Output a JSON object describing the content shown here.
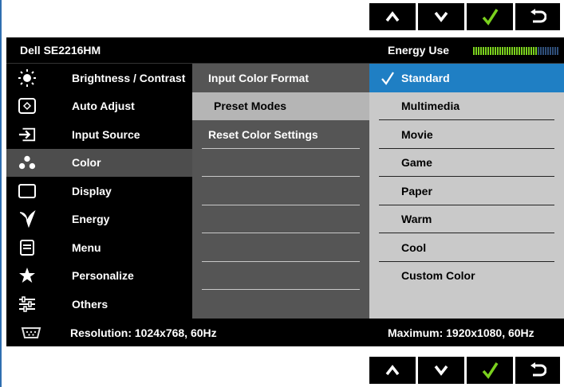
{
  "header": {
    "model": "Dell SE2216HM",
    "energy_label": "Energy Use",
    "energy_level": 0.75,
    "energy_color": "#7bd11e"
  },
  "nav_buttons": [
    {
      "name": "up-icon"
    },
    {
      "name": "down-icon"
    },
    {
      "name": "checkmark-icon",
      "color": "#7bd11e"
    },
    {
      "name": "back-icon"
    }
  ],
  "menu": {
    "items": [
      {
        "label": "Brightness / Contrast",
        "icon": "brightness-icon"
      },
      {
        "label": "Auto Adjust",
        "icon": "auto-adjust-icon"
      },
      {
        "label": "Input Source",
        "icon": "input-source-icon"
      },
      {
        "label": "Color",
        "icon": "color-icon",
        "active": true
      },
      {
        "label": "Display",
        "icon": "display-icon"
      },
      {
        "label": "Energy",
        "icon": "energy-icon"
      },
      {
        "label": "Menu",
        "icon": "menu-icon"
      },
      {
        "label": "Personalize",
        "icon": "star-icon"
      },
      {
        "label": "Others",
        "icon": "others-icon"
      }
    ]
  },
  "submenu": {
    "items": [
      {
        "label": "Input Color Format"
      },
      {
        "label": "Preset Modes"
      },
      {
        "label": "Reset Color Settings"
      }
    ]
  },
  "options": {
    "items": [
      {
        "label": "Standard",
        "selected": true
      },
      {
        "label": "Multimedia"
      },
      {
        "label": "Movie"
      },
      {
        "label": "Game"
      },
      {
        "label": "Paper"
      },
      {
        "label": "Warm"
      },
      {
        "label": "Cool"
      },
      {
        "label": "Custom Color"
      }
    ],
    "selected_color": "#1f7fc4"
  },
  "footer": {
    "current_resolution": "Resolution: 1024x768, 60Hz",
    "max_resolution": "Maximum: 1920x1080, 60Hz"
  }
}
